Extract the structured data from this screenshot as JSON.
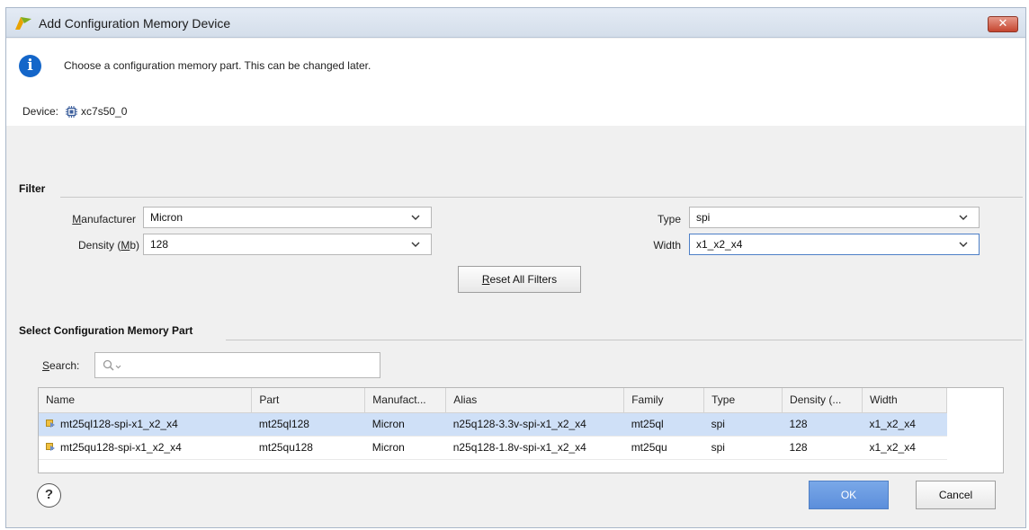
{
  "window": {
    "title": "Add Configuration Memory Device",
    "close_label": "✕"
  },
  "banner": {
    "message": "Choose a configuration memory part. This can be changed later.",
    "device_label": "Device:",
    "device_value": "xc7s50_0"
  },
  "filter": {
    "title": "Filter",
    "manufacturer": {
      "label_pre": "",
      "label_key": "M",
      "label_post": "anufacturer",
      "value": "Micron"
    },
    "density": {
      "label_pre": "Density (",
      "label_key": "M",
      "label_post": "b)",
      "value": "128"
    },
    "type": {
      "label": "Type",
      "value": "spi"
    },
    "width": {
      "label": "Width",
      "value": "x1_x2_x4"
    },
    "reset_label_key": "R",
    "reset_label_rest": "eset All Filters"
  },
  "parts": {
    "title": "Select Configuration Memory Part",
    "search_label_key": "S",
    "search_label_rest": "earch:",
    "search_value": "",
    "columns": [
      "Name",
      "Part",
      "Manufact...",
      "Alias",
      "Family",
      "Type",
      "Density (...",
      "Width"
    ],
    "rows": [
      [
        "mt25ql128-spi-x1_x2_x4",
        "mt25ql128",
        "Micron",
        "n25q128-3.3v-spi-x1_x2_x4",
        "mt25ql",
        "spi",
        "128",
        "x1_x2_x4"
      ],
      [
        "mt25qu128-spi-x1_x2_x4",
        "mt25qu128",
        "Micron",
        "n25q128-1.8v-spi-x1_x2_x4",
        "mt25qu",
        "spi",
        "128",
        "x1_x2_x4"
      ]
    ],
    "selected_row": 0
  },
  "footer": {
    "help_label": "?",
    "ok_label": "OK",
    "cancel_label": "Cancel"
  },
  "colors": {
    "accent": "#5b8edb",
    "selection": "#cfe0f7",
    "info": "#1466c9"
  }
}
